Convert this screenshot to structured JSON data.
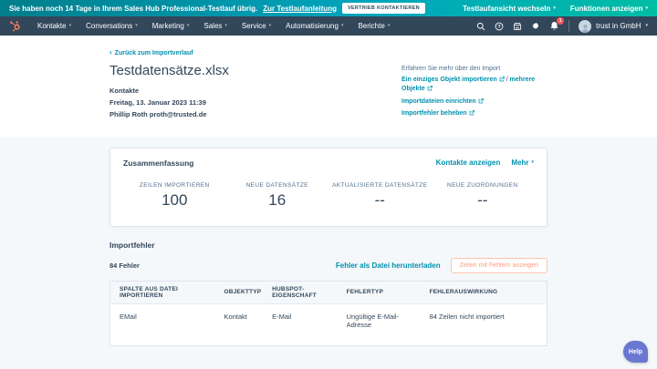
{
  "icons": {
    "caret_down": "▾",
    "back_chevron": "‹"
  },
  "banner": {
    "message": "Sie haben noch 14 Tage in Ihrem Sales Hub Professional-Testlauf übrig.",
    "guide_link": "Zur Testlaufanleitung",
    "contact_button": "Vertrieb kontaktieren",
    "switch_view": "Testlaufansicht wechseln",
    "show_features": "Funktionen anzeigen"
  },
  "nav": {
    "items": [
      "Kontakte",
      "Conversations",
      "Marketing",
      "Sales",
      "Service",
      "Automatisierung",
      "Berichte"
    ],
    "notification_count": "1",
    "account": "trust in GmbH"
  },
  "page": {
    "back_link": "Zurück zum Importverlauf",
    "title": "Testdatensätze.xlsx",
    "object_type": "Kontakte",
    "date": "Freitag, 13. Januar 2023 11:39",
    "author": "Phillip Roth proth@trusted.de",
    "learn": {
      "heading": "Erfahren Sie mehr über den Import",
      "link_single_object": "Ein einziges Objekt importieren",
      "separator": "/",
      "link_multiple_objects": "mehrere Objekte",
      "link_setup_files": "Importdateien einrichten",
      "link_fix_errors": "Importfehler beheben"
    }
  },
  "summary": {
    "title": "Zusammenfassung",
    "view_link": "Kontakte anzeigen",
    "more_link": "Mehr",
    "stats": [
      {
        "label": "ZEILEN IMPORTIEREN",
        "value": "100"
      },
      {
        "label": "NEUE DATENSÄTZE",
        "value": "16"
      },
      {
        "label": "AKTUALISIERTE DATENSÄTZE",
        "value": "--"
      },
      {
        "label": "NEUE ZUORDNUNGEN",
        "value": "--"
      }
    ]
  },
  "errors": {
    "title": "Importfehler",
    "count": "84 Fehler",
    "download_link": "Fehler als Datei herunterladen",
    "show_rows_button": "Zeilen mit Fehlern anzeigen",
    "table": {
      "headers": [
        "SPALTE AUS DATEI IMPORTIEREN",
        "OBJEKTTYP",
        "HUBSPOT-EIGENSCHAFT",
        "FEHLERTYP",
        "FEHLERAUSWIRKUNG"
      ],
      "rows": [
        [
          "EMail",
          "Kontakt",
          "E-Mail",
          "Ungültige E-Mail-Adresse",
          "84 Zeilen nicht importiert"
        ]
      ]
    }
  },
  "help_button": "Help"
}
